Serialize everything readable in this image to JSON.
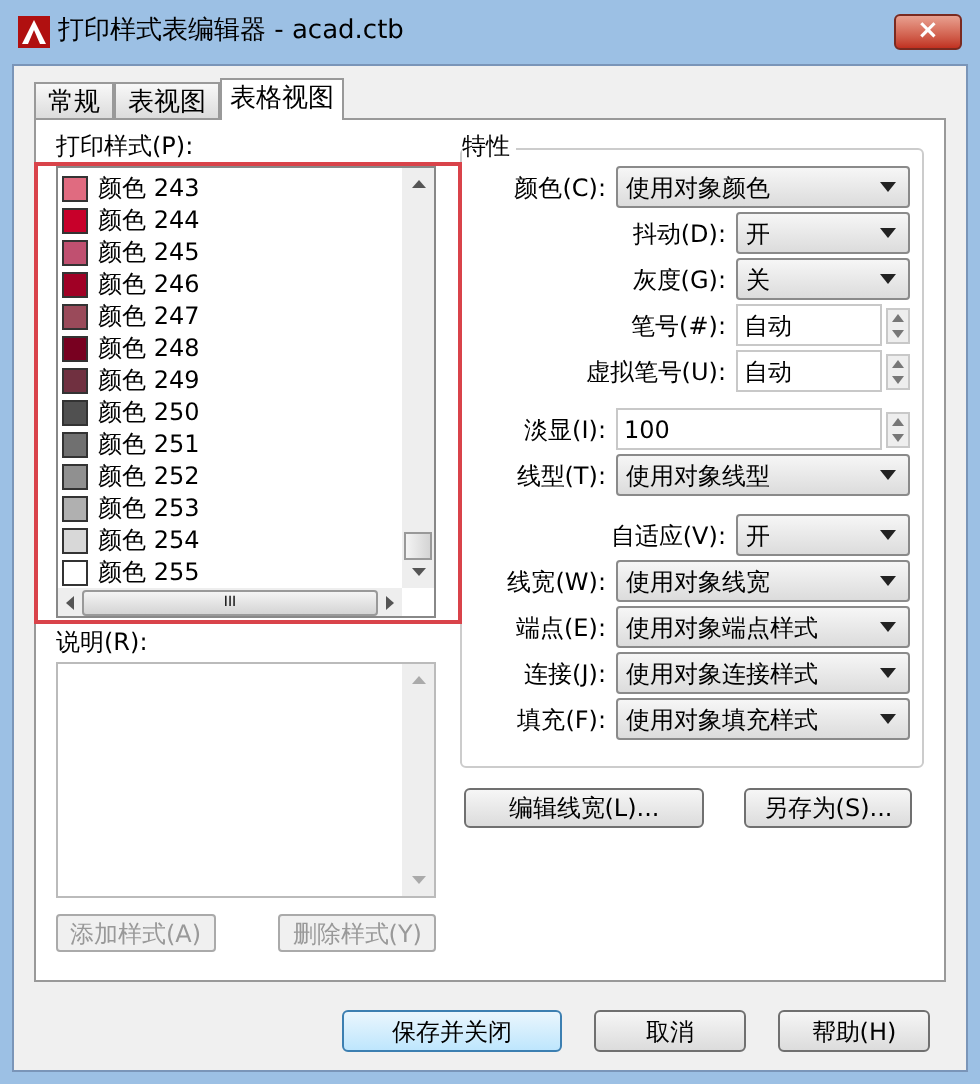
{
  "window": {
    "title": "打印样式表编辑器 - acad.ctb",
    "close": "×"
  },
  "tabs": [
    {
      "label": "常规",
      "selected": false
    },
    {
      "label": "表视图",
      "selected": false
    },
    {
      "label": "表格视图",
      "selected": true
    }
  ],
  "styles_label": "打印样式(P):",
  "styles": [
    {
      "name": "颜色 243",
      "color": "#e06b80"
    },
    {
      "name": "颜色 244",
      "color": "#c8002a"
    },
    {
      "name": "颜色 245",
      "color": "#c05070"
    },
    {
      "name": "颜色 246",
      "color": "#a00025"
    },
    {
      "name": "颜色 247",
      "color": "#9a4a5a"
    },
    {
      "name": "颜色 248",
      "color": "#780020"
    },
    {
      "name": "颜色 249",
      "color": "#703040"
    },
    {
      "name": "颜色 250",
      "color": "#505050"
    },
    {
      "name": "颜色 251",
      "color": "#707070"
    },
    {
      "name": "颜色 252",
      "color": "#909090"
    },
    {
      "name": "颜色 253",
      "color": "#b0b0b0"
    },
    {
      "name": "颜色 254",
      "color": "#d8d8d8"
    },
    {
      "name": "颜色 255",
      "color": "#ffffff"
    }
  ],
  "hscroll_grip": "III",
  "description_label": "说明(R):",
  "style_buttons": [
    {
      "label": "添加样式(A)",
      "disabled": true
    },
    {
      "label": "删除样式(Y)",
      "disabled": true
    }
  ],
  "properties": {
    "title": "特性",
    "rows": [
      {
        "kind": "combo",
        "label": "颜色(C):",
        "value": "使用对象颜色"
      },
      {
        "kind": "shortcombo",
        "label": "抖动(D):",
        "value": "开"
      },
      {
        "kind": "shortcombo",
        "label": "灰度(G):",
        "value": "关"
      },
      {
        "kind": "spin",
        "label": "笔号(#):",
        "value": "自动"
      },
      {
        "kind": "spin",
        "label": "虚拟笔号(U):",
        "value": "自动"
      },
      {
        "kind": "widespin",
        "label": "淡显(I):",
        "value": "100"
      },
      {
        "kind": "combo",
        "label": "线型(T):",
        "value": "使用对象线型"
      },
      {
        "kind": "shortcombo",
        "label": "自适应(V):",
        "value": "开"
      },
      {
        "kind": "combo",
        "label": "线宽(W):",
        "value": "使用对象线宽"
      },
      {
        "kind": "combo",
        "label": "端点(E):",
        "value": "使用对象端点样式"
      },
      {
        "kind": "combo",
        "label": "连接(J):",
        "value": "使用对象连接样式"
      },
      {
        "kind": "combo",
        "label": "填充(F):",
        "value": "使用对象填充样式"
      }
    ]
  },
  "property_buttons": [
    "编辑线宽(L)...",
    "另存为(S)..."
  ],
  "footer_buttons": [
    "保存并关闭",
    "取消",
    "帮助(H)"
  ]
}
